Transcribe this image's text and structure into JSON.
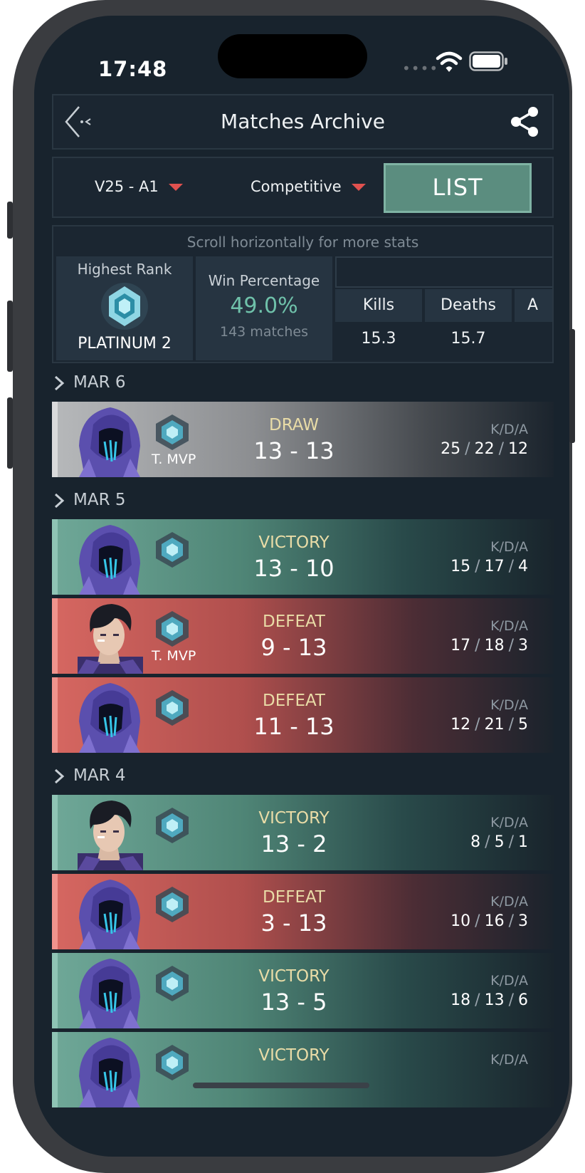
{
  "status_bar": {
    "time": "17:48",
    "dots": "••••"
  },
  "header": {
    "title": "Matches Archive"
  },
  "filters": {
    "season": "V25 - A1",
    "queue": "Competitive",
    "view_button": "LIST"
  },
  "stats": {
    "hint": "Scroll horizontally for more stats",
    "highest_rank_label": "Highest Rank",
    "highest_rank": "PLATINUM 2",
    "win_percentage_label": "Win Percentage",
    "win_percentage": "49.0%",
    "matches": "143 matches",
    "columns": [
      {
        "label": "Kills",
        "value": "15.3"
      },
      {
        "label": "Deaths",
        "value": "15.7"
      },
      {
        "label": "A",
        "value": ""
      }
    ]
  },
  "dates": [
    "MAR 6",
    "MAR 5",
    "MAR 4"
  ],
  "kda_label": "K/D/A",
  "matches": [
    {
      "result": "DRAW",
      "score": "13 - 13",
      "k": "25",
      "d": "22",
      "a": "12",
      "mvp": "T. MVP",
      "outcome": "draw",
      "agent": "hooded"
    },
    {
      "result": "VICTORY",
      "score": "13 - 10",
      "k": "15",
      "d": "17",
      "a": "4",
      "mvp": "",
      "outcome": "victory",
      "agent": "hooded"
    },
    {
      "result": "DEFEAT",
      "score": "9 - 13",
      "k": "17",
      "d": "18",
      "a": "3",
      "mvp": "T. MVP",
      "outcome": "defeat",
      "agent": "dark-hair"
    },
    {
      "result": "DEFEAT",
      "score": "11 - 13",
      "k": "12",
      "d": "21",
      "a": "5",
      "mvp": "",
      "outcome": "defeat",
      "agent": "hooded"
    },
    {
      "result": "VICTORY",
      "score": "13 - 2",
      "k": "8",
      "d": "5",
      "a": "1",
      "mvp": "",
      "outcome": "victory",
      "agent": "dark-hair"
    },
    {
      "result": "DEFEAT",
      "score": "3 - 13",
      "k": "10",
      "d": "16",
      "a": "3",
      "mvp": "",
      "outcome": "defeat",
      "agent": "hooded"
    },
    {
      "result": "VICTORY",
      "score": "13 - 5",
      "k": "18",
      "d": "13",
      "a": "6",
      "mvp": "",
      "outcome": "victory",
      "agent": "hooded"
    },
    {
      "result": "VICTORY",
      "score": "",
      "k": "",
      "d": "",
      "a": "",
      "mvp": "",
      "outcome": "victory",
      "agent": "hooded"
    }
  ],
  "colors": {
    "accent": "#5b8d7f",
    "victory": "#6fa898",
    "defeat": "#d66761",
    "draw": "#b7b9bb",
    "caret": "#e0514f"
  },
  "icons": [
    "back-icon",
    "share-icon",
    "rank-icon",
    "chevron-right-icon",
    "wifi-icon",
    "battery-icon"
  ]
}
